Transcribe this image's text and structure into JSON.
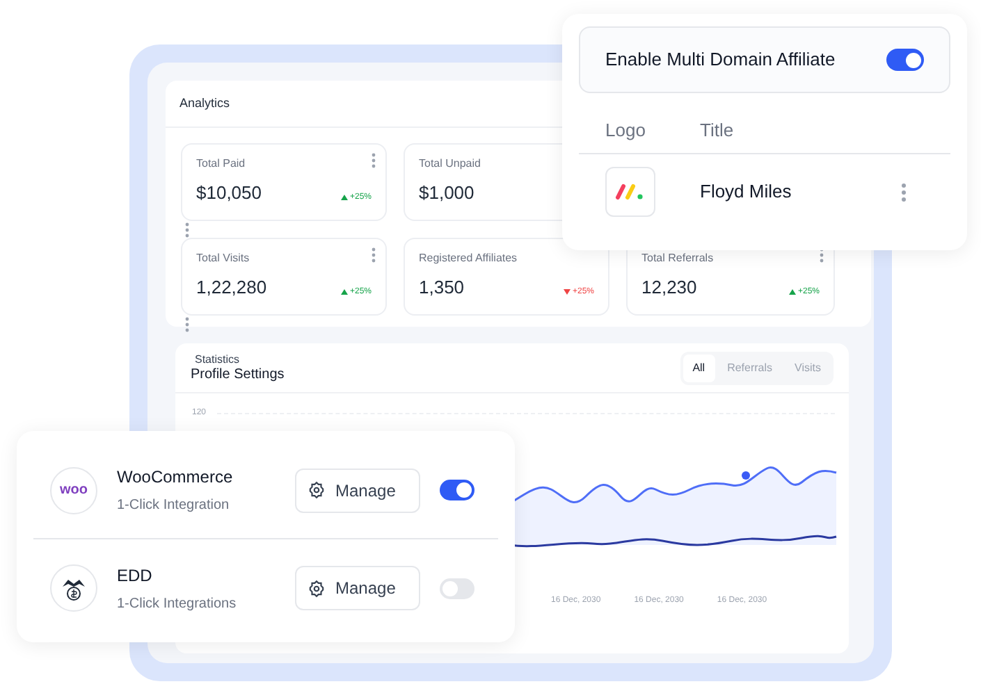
{
  "analytics": {
    "title": "Analytics",
    "stat_rows": [
      [
        {
          "label": "Total Paid",
          "value": "$10,050",
          "change": "+25%",
          "falling": false,
          "menu": true
        },
        {
          "label": "Total Unpaid",
          "value": "$1,000"
        }
      ],
      [
        {
          "label": "Total Visits",
          "value": "1,22,280",
          "change": "+25%",
          "falling": false,
          "menu": true
        },
        {
          "label": "Registered Affiliates",
          "value": "1,350",
          "change": "+25%",
          "falling": true,
          "menu": false
        },
        {
          "label": "Total Referrals",
          "value": "12,230",
          "change": "+25%",
          "falling": false,
          "menu": true
        }
      ]
    ]
  },
  "statistics": {
    "title": "Statistics",
    "subtitle": "Profile Settings",
    "tabs": [
      {
        "label": "All",
        "selected": true
      },
      {
        "label": "Referrals",
        "selected": false
      },
      {
        "label": "Visits",
        "selected": false
      }
    ],
    "y_tick": "120",
    "x_labels": [
      "16 Dec, 2030",
      "16 Dec, 2030",
      "16 Dec, 2030"
    ]
  },
  "domain": {
    "label": "Enable Multi Domain Affiliate",
    "on": true,
    "columns": [
      "Logo",
      "Title"
    ],
    "rows": [
      {
        "title": "Floyd Miles"
      }
    ]
  },
  "integrations": [
    {
      "kind": "woo",
      "logo_text": "woo",
      "name": "WooCommerce",
      "subtitle": "1-Click Integration",
      "button": "Manage",
      "on": true
    },
    {
      "kind": "edd",
      "name": "EDD",
      "subtitle": "1-Click Integrations",
      "button": "Manage",
      "on": false
    }
  ]
}
